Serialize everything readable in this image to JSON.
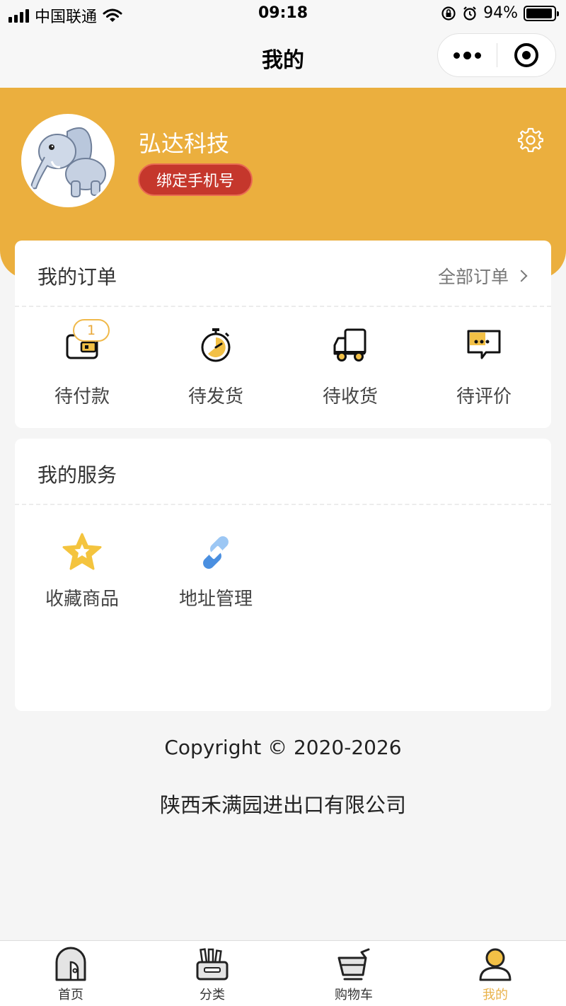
{
  "status_bar": {
    "carrier": "中国联通",
    "time": "09:18",
    "battery_percent": "94%",
    "battery_level": 0.94
  },
  "nav": {
    "title": "我的"
  },
  "profile": {
    "name": "弘达科技",
    "bind_phone_label": "绑定手机号"
  },
  "orders": {
    "title": "我的订单",
    "all_label": "全部订单",
    "items": [
      {
        "label": "待付款",
        "badge": "1",
        "icon": "wallet-icon"
      },
      {
        "label": "待发货",
        "icon": "stopwatch-icon"
      },
      {
        "label": "待收货",
        "icon": "truck-icon"
      },
      {
        "label": "待评价",
        "icon": "comment-icon"
      }
    ]
  },
  "services": {
    "title": "我的服务",
    "items": [
      {
        "label": "收藏商品",
        "icon": "star-icon"
      },
      {
        "label": "地址管理",
        "icon": "link-icon"
      }
    ]
  },
  "footer": {
    "copyright": "Copyright © 2020-2026",
    "company": "陕西禾满园进出口有限公司"
  },
  "tab_bar": {
    "items": [
      {
        "label": "首页",
        "icon": "home-icon"
      },
      {
        "label": "分类",
        "icon": "category-icon"
      },
      {
        "label": "购物车",
        "icon": "cart-icon"
      },
      {
        "label": "我的",
        "icon": "profile-icon",
        "active": true
      }
    ]
  },
  "colors": {
    "accent": "#ebaf3e",
    "bind_button": "#c5372c",
    "active_tab": "#e9b24a",
    "link_blue": "#4a8fe0"
  }
}
